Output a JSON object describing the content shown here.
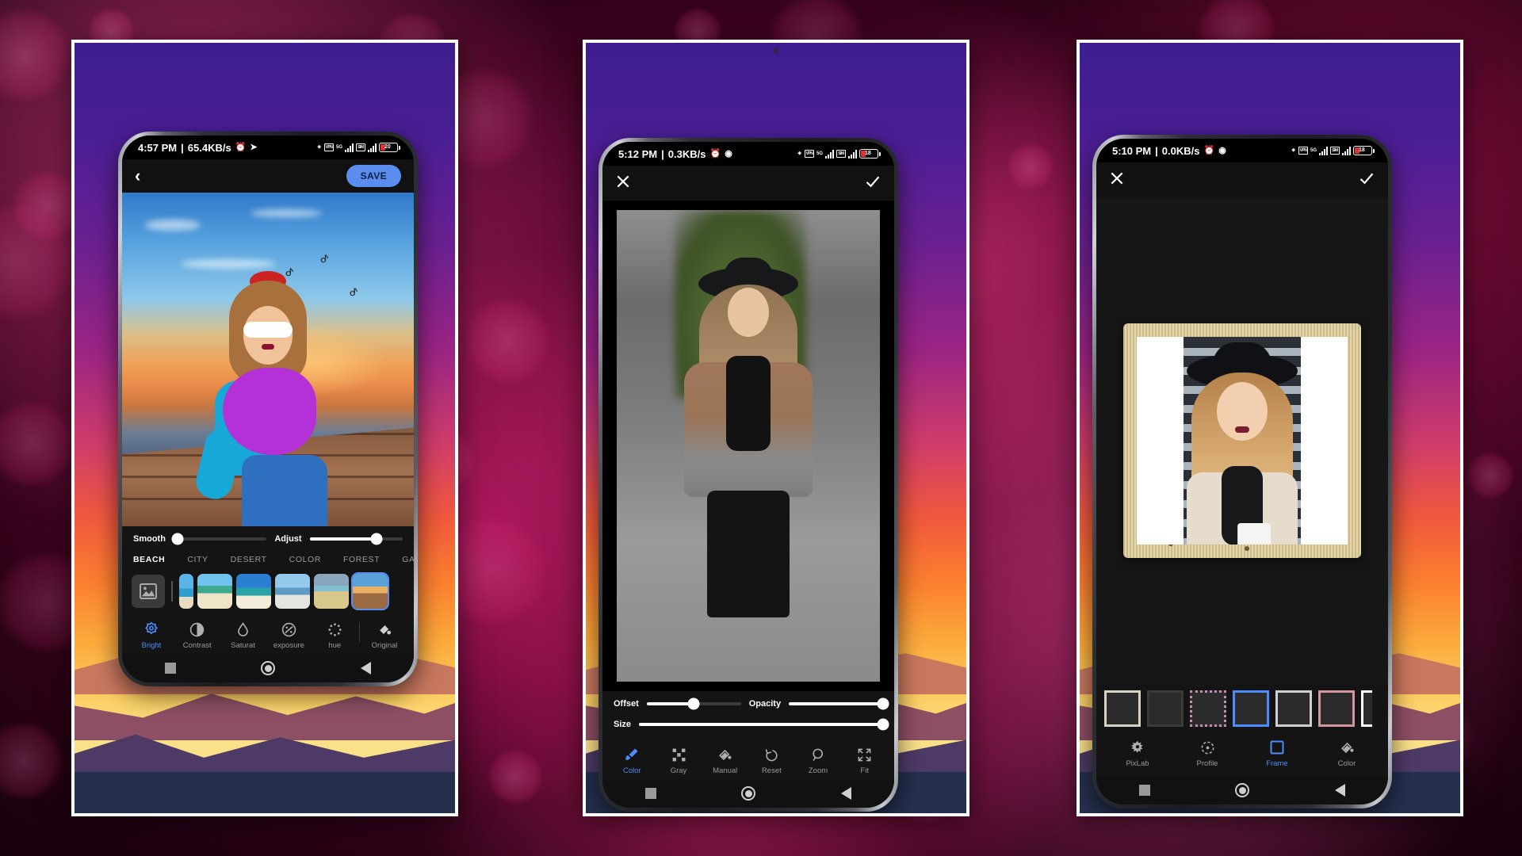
{
  "background": {
    "style": "pink-magenta-bokeh-glitter"
  },
  "theme": {
    "accent": "#4d8dfb",
    "save_bg": "#5b8def",
    "panel_bg": "#141414",
    "bar_bg": "#111111"
  },
  "screens": [
    {
      "id": "background-editor",
      "status_bar": {
        "time": "4:57 PM",
        "separator": "|",
        "net_speed": "65.4KB/s",
        "icons": [
          "alarm-icon",
          "telegram-icon",
          "bluetooth-icon",
          "vpn-icon",
          "signal-5g-icon",
          "signal-bars-icon",
          "battery-icon"
        ],
        "battery_level": "20"
      },
      "appbar": {
        "back_icon": "chevron-left-icon",
        "save_label": "SAVE"
      },
      "sliders": [
        {
          "label": "Smooth",
          "value": 4
        },
        {
          "label": "Adjust",
          "value": 72
        }
      ],
      "categories": [
        {
          "label": "BEACH",
          "selected": true
        },
        {
          "label": "CITY",
          "selected": false
        },
        {
          "label": "DESERT",
          "selected": false
        },
        {
          "label": "COLOR",
          "selected": false
        },
        {
          "label": "FOREST",
          "selected": false
        },
        {
          "label": "GAR",
          "selected": false
        }
      ],
      "thumbnails": [
        {
          "name": "no-background",
          "icon": "image-placeholder-icon",
          "selected": false
        },
        {
          "name": "beach-1",
          "selected": false
        },
        {
          "name": "beach-2",
          "selected": false
        },
        {
          "name": "beach-3",
          "selected": false
        },
        {
          "name": "beach-4",
          "selected": false
        },
        {
          "name": "beach-5",
          "selected": false
        },
        {
          "name": "beach-pier",
          "selected": true
        }
      ],
      "tools": [
        {
          "label": "Bright",
          "icon": "brightness-icon",
          "active": true
        },
        {
          "label": "Contrast",
          "icon": "contrast-icon",
          "active": false
        },
        {
          "label": "Saturat",
          "icon": "saturation-droplet-icon",
          "active": false
        },
        {
          "label": "exposure",
          "icon": "exposure-icon",
          "active": false
        },
        {
          "label": "hue",
          "icon": "hue-dots-icon",
          "active": false
        },
        {
          "label": "Original",
          "icon": "original-paint-icon",
          "active": false
        }
      ],
      "nav": [
        "recents-square-icon",
        "home-circle-icon",
        "back-triangle-icon"
      ]
    },
    {
      "id": "color-splash-editor",
      "status_bar": {
        "time": "5:12 PM",
        "separator": "|",
        "net_speed": "0.3KB/s",
        "icons": [
          "alarm-icon",
          "chrome-icon",
          "bluetooth-icon",
          "vpn-icon",
          "signal-5g-icon",
          "signal-bars-icon",
          "battery-icon"
        ],
        "battery_level": "18"
      },
      "appbar": {
        "close_icon": "close-x-icon",
        "confirm_icon": "checkmark-icon"
      },
      "sliders": [
        {
          "label": "Offset",
          "value": 50
        },
        {
          "label": "Opacity",
          "value": 100
        },
        {
          "label": "Size",
          "value": 100
        }
      ],
      "tools": [
        {
          "label": "Color",
          "icon": "brush-icon",
          "active": true
        },
        {
          "label": "Gray",
          "icon": "checker-grid-icon",
          "active": false
        },
        {
          "label": "Manual",
          "icon": "paint-bucket-icon",
          "active": false
        },
        {
          "label": "Reset",
          "icon": "undo-arrow-icon",
          "active": false
        },
        {
          "label": "Zoom",
          "icon": "magnifier-icon",
          "active": false
        },
        {
          "label": "Fit",
          "icon": "expand-arrows-icon",
          "active": false
        }
      ],
      "nav": [
        "recents-square-icon",
        "home-circle-icon",
        "back-triangle-icon"
      ]
    },
    {
      "id": "frame-editor",
      "status_bar": {
        "time": "5:10 PM",
        "separator": "|",
        "net_speed": "0.0KB/s",
        "icons": [
          "alarm-icon",
          "chrome-icon",
          "bluetooth-icon",
          "vpn-icon",
          "signal-5g-icon",
          "signal-bars-icon",
          "battery-icon"
        ],
        "battery_level": "18"
      },
      "appbar": {
        "close_icon": "close-x-icon",
        "confirm_icon": "checkmark-icon"
      },
      "frames": [
        {
          "name": "frame-1",
          "border": "#d8d2c4",
          "selected": false
        },
        {
          "name": "frame-2",
          "border": "#3a3a3a",
          "selected": false
        },
        {
          "name": "frame-3",
          "border": "#c38bb8",
          "selected": false
        },
        {
          "name": "frame-4",
          "border": "#4d8dfb",
          "selected": true
        },
        {
          "name": "frame-5",
          "border": "#cfcfcf",
          "selected": false
        },
        {
          "name": "frame-6",
          "border": "#d3969b",
          "selected": false
        },
        {
          "name": "frame-7",
          "border": "#ffffff",
          "selected": false
        }
      ],
      "tools": [
        {
          "label": "PixLab",
          "icon": "splash-icon",
          "active": false
        },
        {
          "label": "Profile",
          "icon": "profile-dots-icon",
          "active": false
        },
        {
          "label": "Frame",
          "icon": "frame-square-icon",
          "active": true
        },
        {
          "label": "Color",
          "icon": "paint-bucket-icon",
          "active": false
        }
      ],
      "nav": [
        "recents-square-icon",
        "home-circle-icon",
        "back-triangle-icon"
      ]
    }
  ]
}
